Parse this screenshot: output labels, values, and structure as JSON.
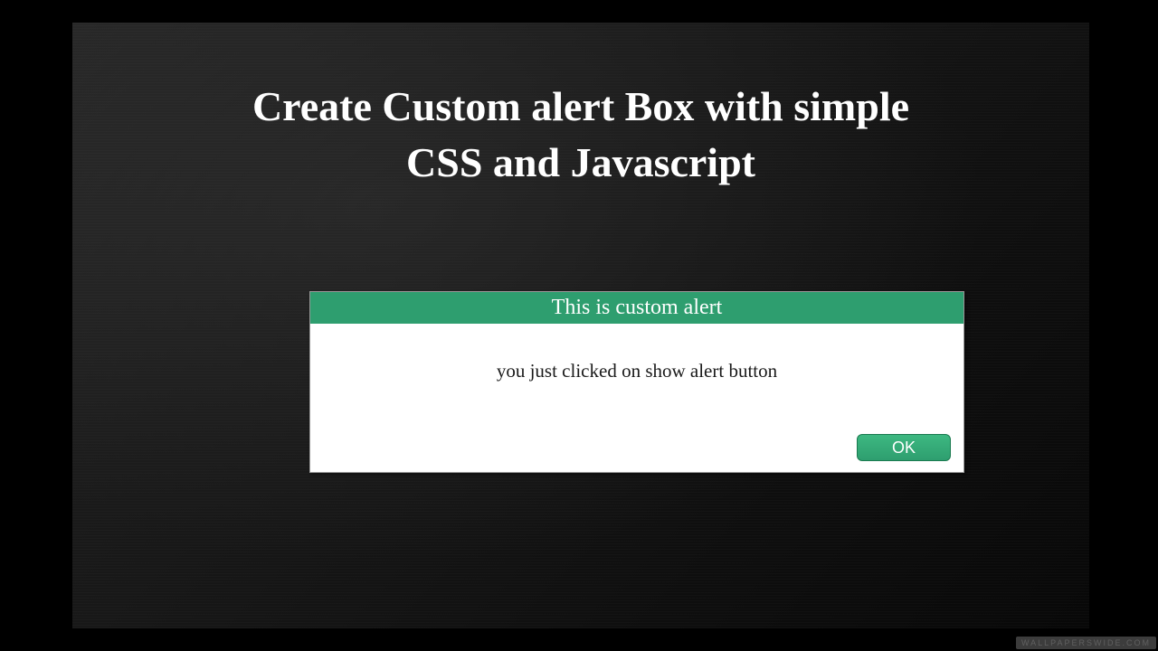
{
  "heading": {
    "line1": "Create Custom alert Box with simple",
    "line2": "CSS and Javascript"
  },
  "alert": {
    "title": "This is custom alert",
    "message": "you just clicked on show alert button",
    "button_label": "OK"
  },
  "watermark": "WALLPAPERSWIDE.COM",
  "colors": {
    "accent_green": "#2e9e6f",
    "background_black": "#000000",
    "panel_dark": "#1a1a1a",
    "text_white": "#ffffff"
  }
}
